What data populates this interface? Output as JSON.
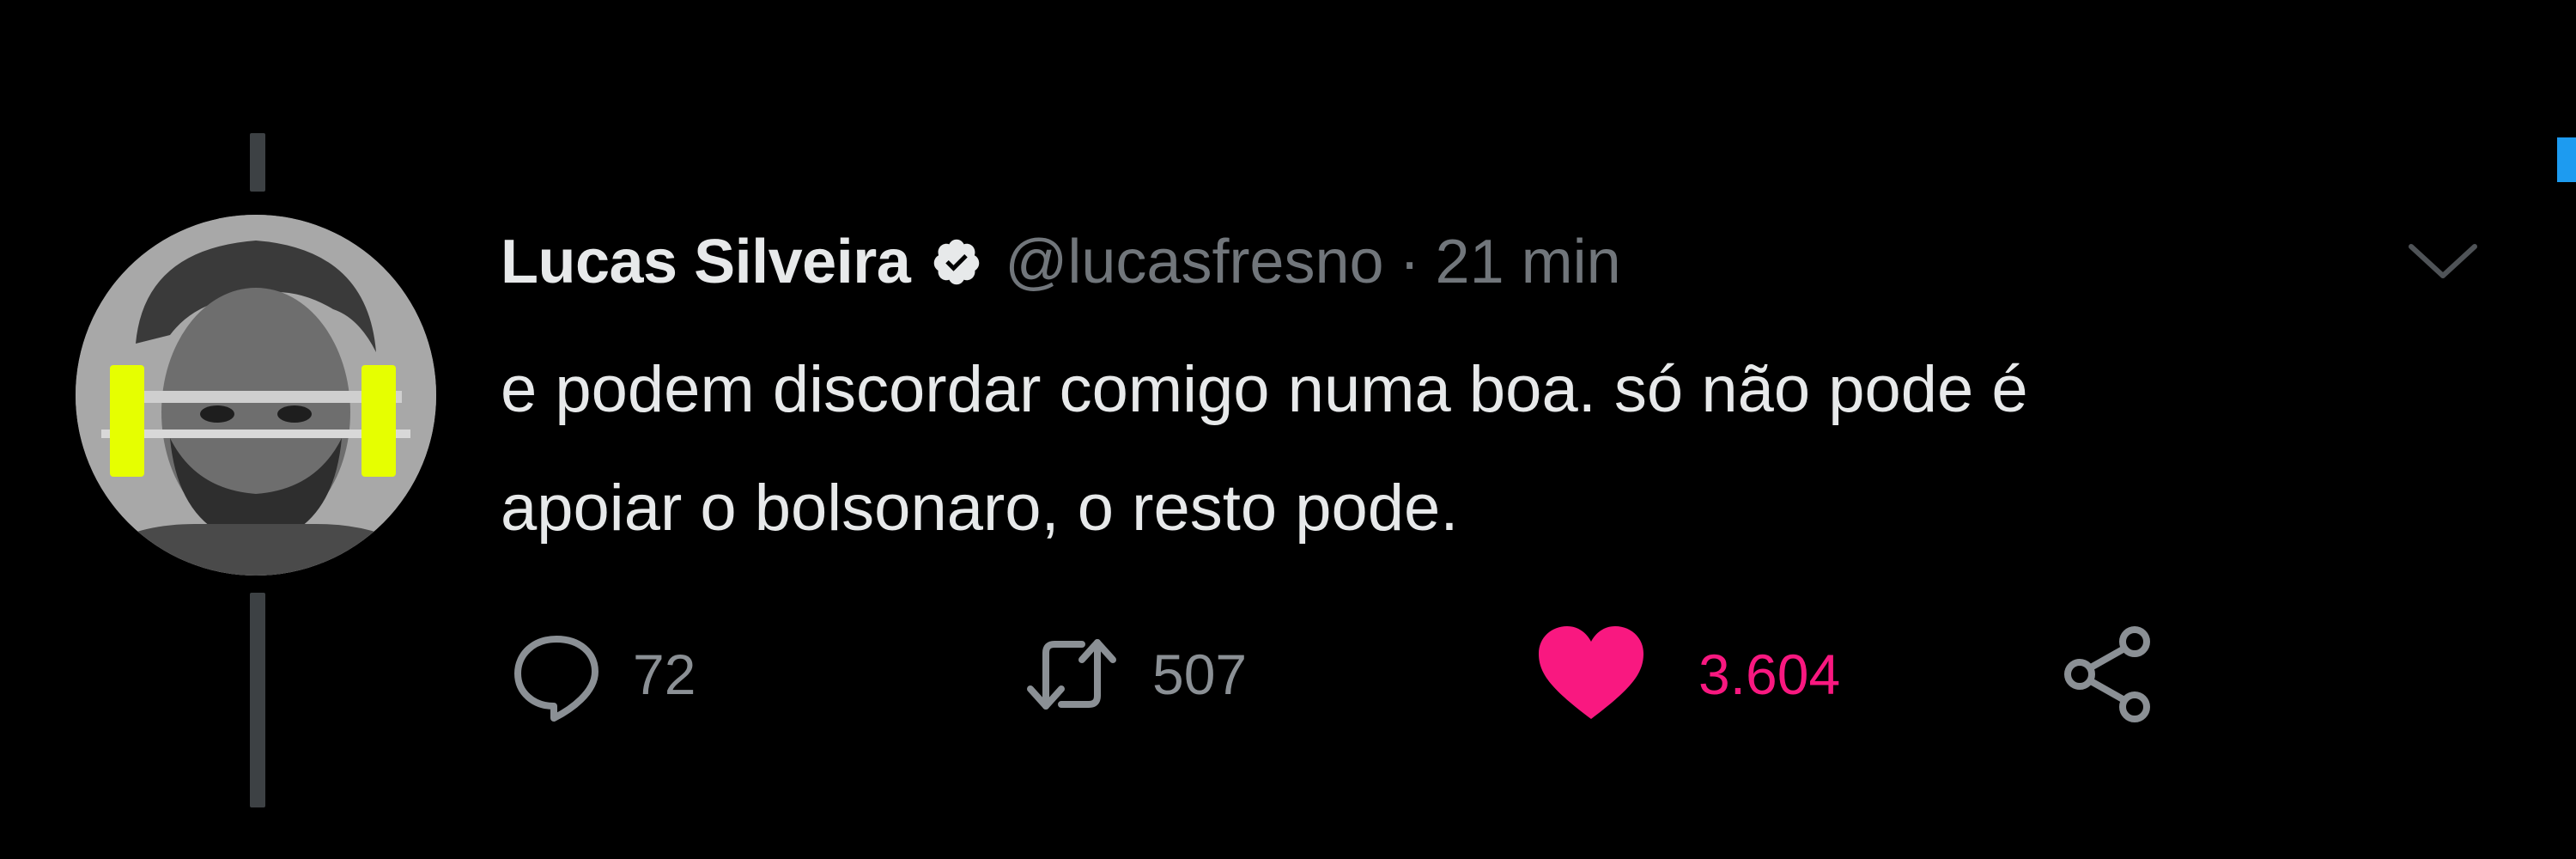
{
  "tweet": {
    "author_name": "Lucas Silveira",
    "handle": "@lucasfresno",
    "separator": "·",
    "timestamp": "21 min",
    "verified": true,
    "text": "e podem discordar comigo numa boa. só não pode é\napoiar o bolsonaro, o resto pode.",
    "actions": {
      "reply_count": "72",
      "retweet_count": "507",
      "like_count": "3.604",
      "liked": true
    }
  },
  "icons": {
    "avatar": "avatar",
    "verified": "verified-badge-icon",
    "more": "chevron-down-icon",
    "reply": "reply-icon",
    "retweet": "retweet-icon",
    "like": "heart-icon",
    "share": "share-icon"
  },
  "colors": {
    "background": "#000000",
    "text": "#e7e9ea",
    "muted": "#71767b",
    "like": "#f91880",
    "thread_line": "#3d4144",
    "accent": "#1d9bf0"
  }
}
